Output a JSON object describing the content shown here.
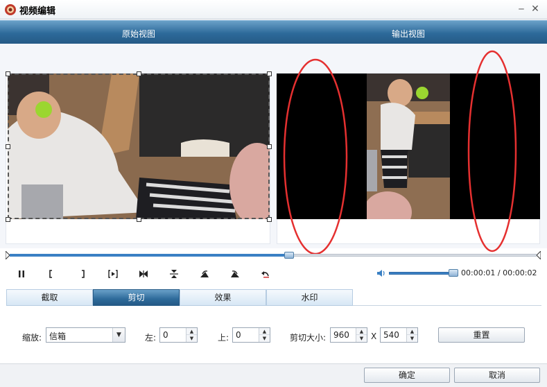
{
  "window": {
    "title": "视频编辑",
    "minimize_glyph": "‒",
    "close_glyph": "✕"
  },
  "views": {
    "original_label": "原始视图",
    "output_label": "输出视图"
  },
  "playback": {
    "progress": 0.53,
    "volume": 0.97,
    "time_display": "00:00:01 / 00:00:02",
    "controls": [
      {
        "name": "pause-icon"
      },
      {
        "name": "set-start-icon"
      },
      {
        "name": "set-end-icon"
      },
      {
        "name": "play-selection-icon"
      },
      {
        "name": "prev-next-icon"
      },
      {
        "name": "flip-vertical-icon"
      },
      {
        "name": "rotate-left-icon"
      },
      {
        "name": "rotate-right-icon"
      },
      {
        "name": "undo-icon"
      }
    ]
  },
  "tabs": [
    {
      "label": "截取",
      "active": false
    },
    {
      "label": "剪切",
      "active": true
    },
    {
      "label": "效果",
      "active": false
    },
    {
      "label": "水印",
      "active": false
    }
  ],
  "crop": {
    "zoom_label": "缩放:",
    "zoom_value": "信箱",
    "left_label": "左:",
    "left_value": "0",
    "top_label": "上:",
    "top_value": "0",
    "size_label": "剪切大小:",
    "width_value": "960",
    "x_label": "X",
    "height_value": "540",
    "reset_label": "重置"
  },
  "footer": {
    "ok_label": "确定",
    "cancel_label": "取消"
  },
  "colors": {
    "header_blue": "#2d6a9a",
    "annotation_red": "#e53030",
    "accent_blue": "#3a80c4"
  }
}
